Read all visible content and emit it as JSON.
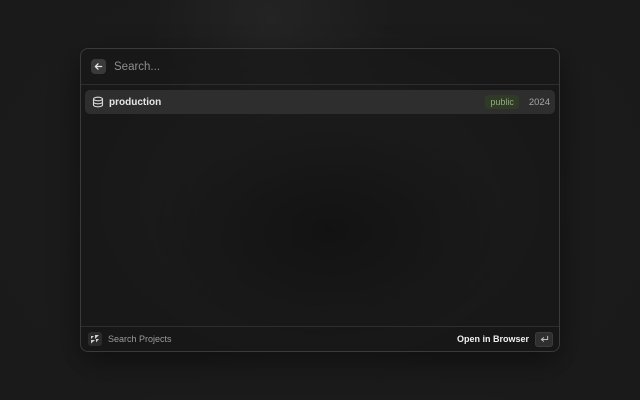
{
  "search": {
    "placeholder": "Search...",
    "value": "",
    "back_icon": "arrow-left-icon"
  },
  "results": [
    {
      "icon": "database-icon",
      "name": "production",
      "badge": "public",
      "year": "2024"
    }
  ],
  "footer": {
    "app_icon": "app-logo-icon",
    "label": "Search Projects",
    "action_label": "Open in Browser",
    "action_key_icon": "enter-key-icon"
  },
  "colors": {
    "badge_bg": "#2f3a27",
    "badge_text": "#93ad7b",
    "row_selected": "#2e2e2e"
  }
}
